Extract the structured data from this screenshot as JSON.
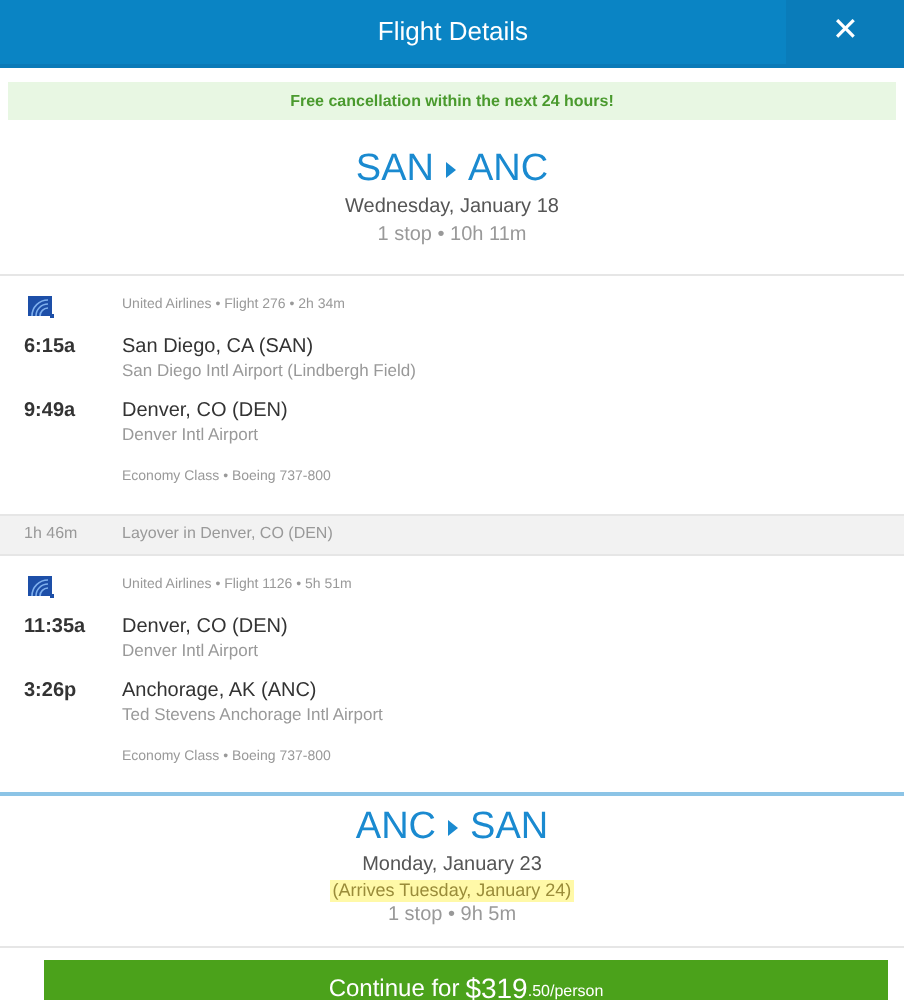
{
  "header": {
    "title": "Flight Details",
    "close": "✕"
  },
  "banner": "Free cancellation within the next 24 hours!",
  "outbound": {
    "from": "SAN",
    "to": "ANC",
    "date": "Wednesday, January 18",
    "summary": "1 stop • 10h 11m"
  },
  "segments": [
    {
      "kind": "leg",
      "flight": "United Airlines • Flight 276 • 2h 34m",
      "stops": [
        {
          "time": "6:15a",
          "city": "San Diego, CA (SAN)",
          "airport": "San Diego Intl Airport (Lindbergh Field)"
        },
        {
          "time": "9:49a",
          "city": "Denver, CO (DEN)",
          "airport": "Denver Intl Airport"
        }
      ],
      "cabin": "Economy Class • Boeing 737-800"
    },
    {
      "kind": "layover",
      "duration": "1h 46m",
      "text": "Layover in Denver, CO (DEN)"
    },
    {
      "kind": "leg",
      "flight": "United Airlines • Flight 1126 • 5h 51m",
      "stops": [
        {
          "time": "11:35a",
          "city": "Denver, CO (DEN)",
          "airport": "Denver Intl Airport"
        },
        {
          "time": "3:26p",
          "city": "Anchorage, AK (ANC)",
          "airport": "Ted Stevens Anchorage Intl Airport"
        }
      ],
      "cabin": "Economy Class • Boeing 737-800"
    }
  ],
  "return": {
    "from": "ANC",
    "to": "SAN",
    "date": "Monday, January 23",
    "arrival_note": "(Arrives Tuesday, January 24)",
    "summary": "1 stop • 9h 5m"
  },
  "continue_button": {
    "label": "Continue for",
    "price": "$319",
    "suffix": ".50/person"
  }
}
